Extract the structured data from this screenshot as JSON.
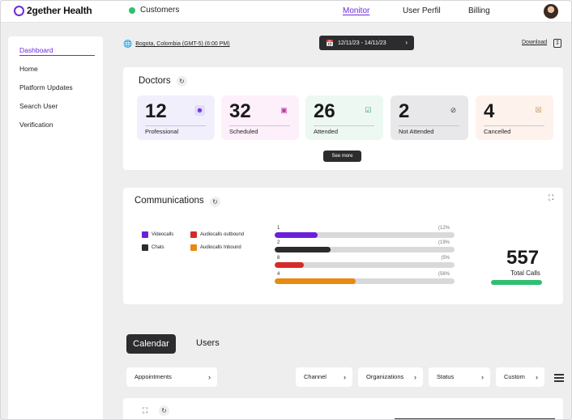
{
  "app": {
    "logo_text": "2gether Health"
  },
  "topbar": {
    "customers_label": "Customers",
    "nav": [
      {
        "label": "Monitor",
        "active": true
      },
      {
        "label": "User Perfil",
        "active": false
      },
      {
        "label": "Billing",
        "active": false
      }
    ]
  },
  "sidebar": {
    "items": [
      {
        "label": "Dashboard",
        "active": true
      },
      {
        "label": "Home"
      },
      {
        "label": "Platform Updates"
      },
      {
        "label": "Search User"
      },
      {
        "label": "Verification"
      }
    ]
  },
  "header": {
    "location": "Bogota, Colombia (GMT-5) (6:00 PM)",
    "date_range": "12/11/23 - 14/11/23",
    "download_label": "Download"
  },
  "doctors": {
    "title": "Doctors",
    "stats": [
      {
        "value": "12",
        "label": "Professional",
        "bg": "#f1effc",
        "icon": "profile-icon"
      },
      {
        "value": "32",
        "label": "Scheduled",
        "bg": "#fdf0fb",
        "icon": "calendar-plus-icon"
      },
      {
        "value": "26",
        "label": "Attended",
        "bg": "#edf8f3",
        "icon": "calendar-check-icon"
      },
      {
        "value": "2",
        "label": "Not Attended",
        "bg": "#e8e8ea",
        "icon": "eye-off-icon"
      },
      {
        "value": "4",
        "label": "Cancelled",
        "bg": "#fdf2ec",
        "icon": "calendar-x-icon"
      }
    ],
    "see_more_label": "See more"
  },
  "communications": {
    "title": "Communications",
    "legend": [
      {
        "label": "Videocalls",
        "color": "#6c1fd9"
      },
      {
        "label": "Audiocalls outbound",
        "color": "#d62a2a"
      },
      {
        "label": "Chats",
        "color": "#2c2c2e"
      },
      {
        "label": "Audiocalls Inbound",
        "color": "#e88a12"
      }
    ],
    "bars": [
      {
        "index": "1",
        "pct": "(12%",
        "fraction": 0.24,
        "color": "#6c1fd9"
      },
      {
        "index": "2",
        "pct": "(19%",
        "fraction": 0.31,
        "color": "#2c2c2e"
      },
      {
        "index": "8",
        "pct": "(5%",
        "fraction": 0.16,
        "color": "#d62a2a"
      },
      {
        "index": "4",
        "pct": "(56%",
        "fraction": 0.45,
        "color": "#e88a12"
      }
    ],
    "total_value": "557",
    "total_label": "Total Calls"
  },
  "tabs": {
    "calendar": "Calendar",
    "users": "Users"
  },
  "filters": {
    "appointments": "Appointments",
    "channel": "Channel",
    "organizations": "Organizations",
    "status": "Status",
    "custom": "Custom"
  }
}
